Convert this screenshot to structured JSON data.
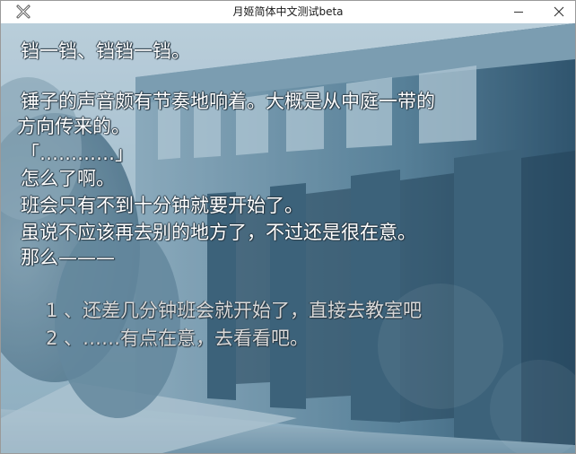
{
  "window": {
    "title": "月姬简体中文测试beta",
    "app_icon": "x-logo-icon",
    "minimize_icon": "minimize-icon",
    "close_icon": "close-icon"
  },
  "scene": {
    "background": "school-building-corridor",
    "palette": {
      "sky": "#cfe0ea",
      "wall": "#6f93a8",
      "shadow": "#2f4e63",
      "text": "#ffffff",
      "choice_text": "#d9d9d9"
    }
  },
  "dialogue": [
    "  铛一铛、铛铛一铛。",
    "",
    "  锤子的声音颇有节奏地响着。大概是从中庭一带的",
    "方向传来的。",
    "「…………」",
    "  怎么了啊。",
    "  班会只有不到十分钟就要开始了。",
    "  虽说不应该再去别的地方了，不过还是很在意。",
    "  那么———"
  ],
  "choices": [
    "1 、还差几分钟班会就开始了，直接去教室吧",
    "2 、……有点在意，去看看吧。"
  ]
}
